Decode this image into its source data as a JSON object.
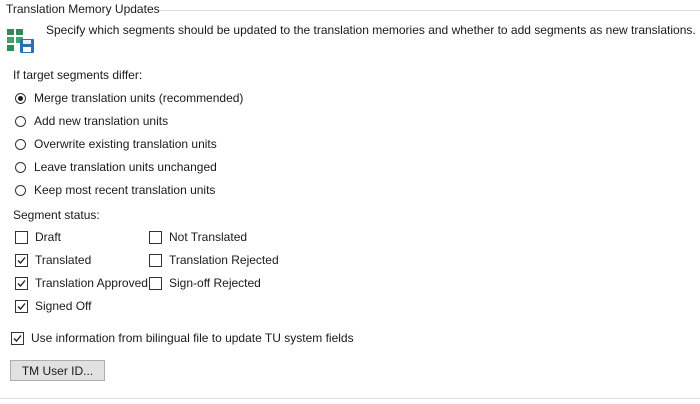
{
  "group": {
    "title": "Translation Memory Updates"
  },
  "description": "Specify which segments should be updated to the translation memories and whether to add segments as new translations.",
  "icon": "translation-memory-save-icon",
  "target_differ": {
    "label": "If target segments differ:",
    "selected": "Merge translation units (recommended)",
    "options": [
      "Merge translation units (recommended)",
      "Add new translation units",
      "Overwrite existing translation units",
      "Leave translation units unchanged",
      "Keep most recent translation units"
    ]
  },
  "segment_status": {
    "label": "Segment status:",
    "items": [
      {
        "label": "Draft",
        "checked": false
      },
      {
        "label": "Translated",
        "checked": true
      },
      {
        "label": "Translation Approved",
        "checked": true
      },
      {
        "label": "Signed Off",
        "checked": true
      },
      {
        "label": "Not Translated",
        "checked": false
      },
      {
        "label": "Translation Rejected",
        "checked": false
      },
      {
        "label": "Sign-off Rejected",
        "checked": false
      }
    ]
  },
  "use_bilingual_info": {
    "label": "Use information from bilingual file to update TU system fields",
    "checked": true
  },
  "tm_user_id_button": "TM User ID..."
}
